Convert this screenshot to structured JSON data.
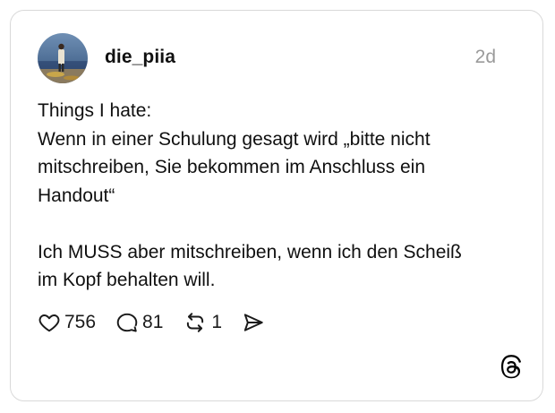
{
  "post": {
    "username": "die_piia",
    "timestamp": "2d",
    "text_lines": [
      "Things I hate:",
      "Wenn in einer Schulung gesagt wird „bitte nicht",
      "mitschreiben, Sie bekommen im Anschluss ein",
      "Handout“",
      "Ich MUSS aber mitschreiben, wenn ich den Scheiß",
      "im Kopf behalten will."
    ]
  },
  "actions": {
    "likes": "756",
    "replies": "81",
    "reposts": "1"
  },
  "icons": {
    "like": "heart-icon",
    "reply": "speech-bubble-icon",
    "repost": "repost-arrows-icon",
    "share": "send-arrow-icon",
    "brand": "threads-logo-icon"
  },
  "colors": {
    "text": "#101010",
    "muted": "#9a9a9a",
    "border": "#d9d9d9"
  }
}
